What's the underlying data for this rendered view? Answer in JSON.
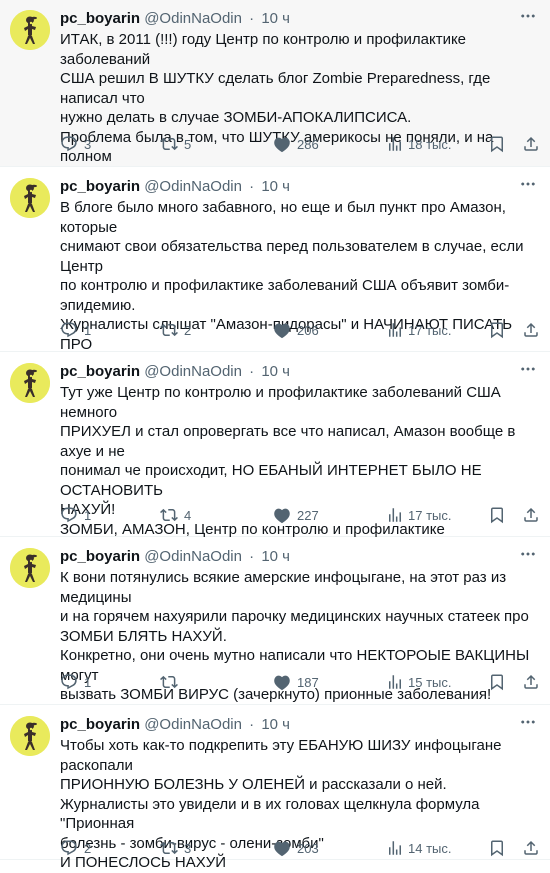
{
  "tweets": [
    {
      "name": "pc_boyarin",
      "handle": "@OdinNaOdin",
      "time": "10 ч",
      "paragraphs": [
        "ИТАК, в 2011 (!!!) году Центр по контролю и профилактике заболеваний\nСША решил В ШУТКУ сделать блог Zombie Preparedness, где написал что\nнужно делать в случае ЗОМБИ-АПОКАЛИПСИСА.",
        "Проблема была в том, что ШУТКУ америкосы не поняли, и на полном\nсерьезе, блять, стали блог шарить!"
      ],
      "replies": "3",
      "retweets": "5",
      "likes": "286",
      "views": "18 тыс."
    },
    {
      "name": "pc_boyarin",
      "handle": "@OdinNaOdin",
      "time": "10 ч",
      "paragraphs": [
        "В блоге было много забавного, но еще и был пункт про Амазон, которые\nснимают свои обязательства перед пользователем в случае, если Центр\nпо контролю и профилактике заболеваний США объявит зомби-\nэпидемию.",
        "Журналисты слышат \"Амазон-пидорасы\" и НАЧИНАЮТ ПИСАТЬ ПРО\nБЛОГ!"
      ],
      "replies": "1",
      "retweets": "2",
      "likes": "206",
      "views": "17 тыс."
    },
    {
      "name": "pc_boyarin",
      "handle": "@OdinNaOdin",
      "time": "10 ч",
      "paragraphs": [
        "Тут уже Центр по контролю и профилактике заболеваний США немного\nПРИХУЕЛ и стал опровергать все что написал, Амазон вообще в ахуе и не\nпонимал че происходит, НО ЕБАНЫЙ ИНТЕРНЕТ БЫЛО НЕ ОСТАНОВИТЬ\nНАХУЙ!",
        "ЗОМБИ, АМАЗОН, Центр по контролю и профилактике заболеваний США,\nСКАНДАЛ!"
      ],
      "replies": "1",
      "retweets": "4",
      "likes": "227",
      "views": "17 тыс."
    },
    {
      "name": "pc_boyarin",
      "handle": "@OdinNaOdin",
      "time": "10 ч",
      "paragraphs": [
        "К вони потянулись всякие амерские инфоцыгане, на этот раз из медицины\nи на горячем нахуярили парочку медицинских научных статеек про\nЗОМБИ БЛЯТЬ НАХУЙ.",
        "Конкретно, они очень мутно написали что НЕКТОРОЫЕ ВАКЦИНЫ могут\nвызвать ЗОМБИ ВИРУС (зачеркнуто) прионные заболевания!"
      ],
      "replies": "1",
      "retweets": "",
      "likes": "187",
      "views": "15 тыс."
    },
    {
      "name": "pc_boyarin",
      "handle": "@OdinNaOdin",
      "time": "10 ч",
      "paragraphs": [
        "Чтобы хоть как-то подкрепить эту ЕБАНУЮ ШИЗУ инфоцыгане раскопали\nПРИОННУЮ БОЛЕЗНЬ У ОЛЕНЕЙ и рассказали о ней.",
        "Журналисты это увидели и в их головах щелкнула формула \"Прионная\nболезнь - зомби-вирус - олени-зомби\"",
        "И ПОНЕСЛОСЬ НАХУЙ"
      ],
      "replies": "2",
      "retweets": "3",
      "likes": "203",
      "views": "14 тыс."
    }
  ]
}
